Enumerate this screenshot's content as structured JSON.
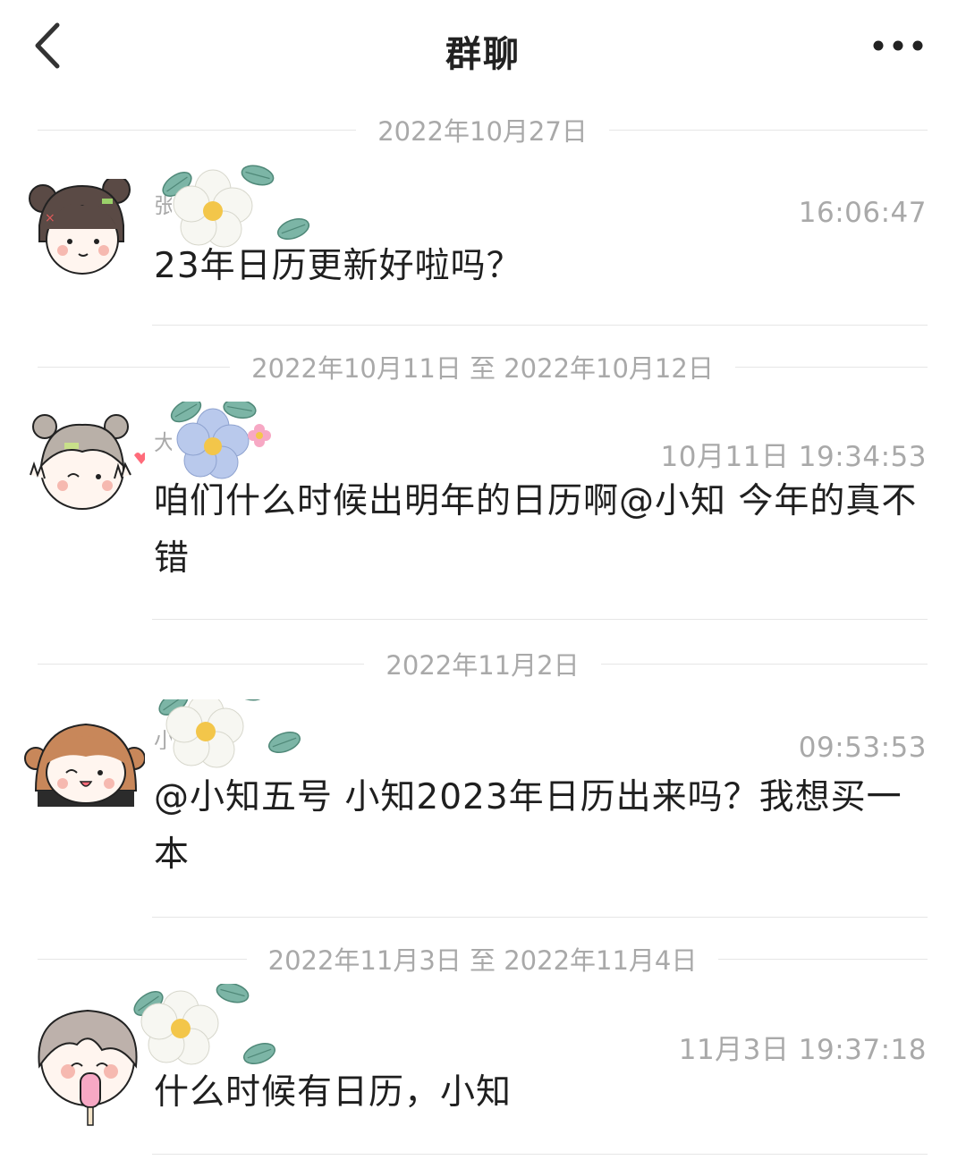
{
  "header": {
    "title": "群聊"
  },
  "messages": [
    {
      "date": "2022年10月27日",
      "nick": "张",
      "time": "16:06:47",
      "text": "23年日历更新好啦吗？"
    },
    {
      "date": "2022年10月11日 至 2022年10月12日",
      "nick": "大",
      "time": "10月11日 19:34:53",
      "text": "咱们什么时候出明年的日历啊@小知 今年的真不错"
    },
    {
      "date": "2022年11月2日",
      "nick": "小",
      "time": "09:53:53",
      "text": "@小知五号 小知2023年日历出来吗？我想买一本"
    },
    {
      "date": "2022年11月3日 至 2022年11月4日",
      "nick": "",
      "time": "11月3日 19:37:18",
      "text": "什么时候有日历，小知"
    }
  ],
  "icons": {
    "back": "chevron-left-icon",
    "more": "more-dots-icon",
    "decoration": "flower-sticker-icon"
  },
  "colors": {
    "text": "#1f1f1f",
    "muted": "#a9a9a9",
    "divider": "#e6e6e6",
    "flower_white": "#f7f7f2",
    "flower_blue": "#b9c9ec",
    "leaf": "#6fa89a",
    "center": "#f3c64a"
  }
}
